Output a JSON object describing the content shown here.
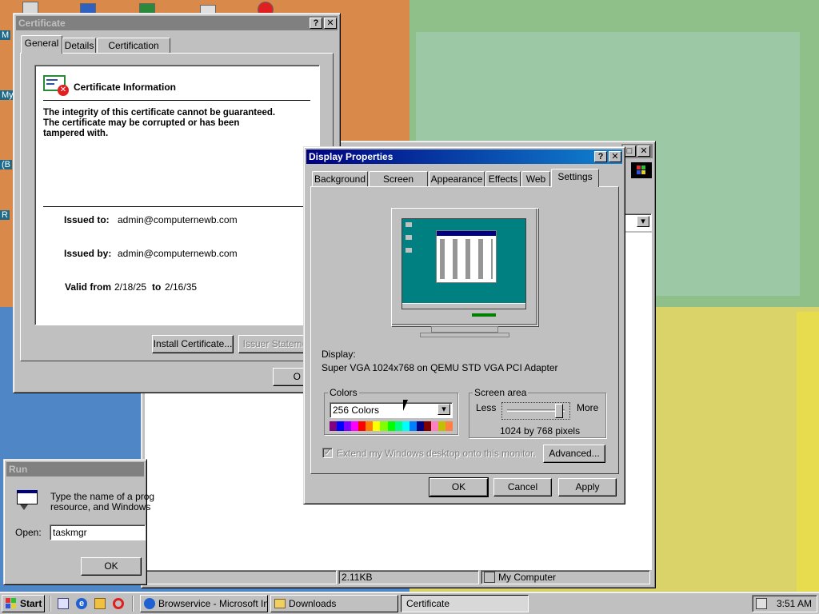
{
  "certificate": {
    "title": "Certificate",
    "tabs": [
      {
        "label": "General"
      },
      {
        "label": "Details"
      },
      {
        "label": "Certification Path"
      }
    ],
    "heading": "Certificate Information",
    "message": "The integrity of this certificate cannot be guaranteed.\nThe certificate may be corrupted or has been\ntampered with.",
    "issued_to_label": "Issued to:",
    "issued_to_value": "admin@computernewb.com",
    "issued_by_label": "Issued by:",
    "issued_by_value": "admin@computernewb.com",
    "valid_from_label": "Valid from",
    "valid_from_value": "2/18/25",
    "valid_to_label": "to",
    "valid_to_value": "2/16/35",
    "install_button": "Install Certificate...",
    "issuer_button": "Issuer Statement",
    "ok_button": "O"
  },
  "display": {
    "title": "Display Properties",
    "tabs": [
      {
        "label": "Background"
      },
      {
        "label": "Screen Saver"
      },
      {
        "label": "Appearance"
      },
      {
        "label": "Effects"
      },
      {
        "label": "Web"
      },
      {
        "label": "Settings"
      }
    ],
    "display_label": "Display:",
    "adapter": "Super VGA 1024x768 on QEMU STD VGA PCI Adapter",
    "colors_group": "Colors",
    "colors_value": "256 Colors",
    "screen_area_group": "Screen area",
    "less_label": "Less",
    "more_label": "More",
    "resolution": "1024 by 768 pixels",
    "extend_label": "Extend my Windows desktop onto this monitor.",
    "advanced_button": "Advanced...",
    "ok_button": "OK",
    "cancel_button": "Cancel",
    "apply_button": "Apply"
  },
  "explorer": {
    "status_size": "2.11KB",
    "status_zone": "My Computer"
  },
  "run": {
    "title": "Run",
    "prompt": "Type the name of a prog\nresource, and Windows",
    "open_label": "Open:",
    "open_value": "taskmgr",
    "ok_button": "OK"
  },
  "desktop": {
    "labels": [
      "M",
      "My",
      "(B",
      "R"
    ]
  },
  "taskbar": {
    "start": "Start",
    "tasks": [
      {
        "label": "Browservice - Microsoft Int..."
      },
      {
        "label": "Downloads"
      },
      {
        "label": "Certificate"
      }
    ],
    "clock": "3:51 AM"
  },
  "colors": {
    "title_active": "#000080",
    "title_inactive": "#808080",
    "face": "#c0c0c0",
    "preview_desktop": "#008080"
  },
  "palette": [
    "#800080",
    "#0000ff",
    "#8000ff",
    "#ff00ff",
    "#ff0000",
    "#ff8000",
    "#ffff00",
    "#80ff00",
    "#00ff00",
    "#00ff80",
    "#00ffff",
    "#0080ff",
    "#000080",
    "#800000",
    "#ff80c0",
    "#c0c000",
    "#ff8040"
  ]
}
